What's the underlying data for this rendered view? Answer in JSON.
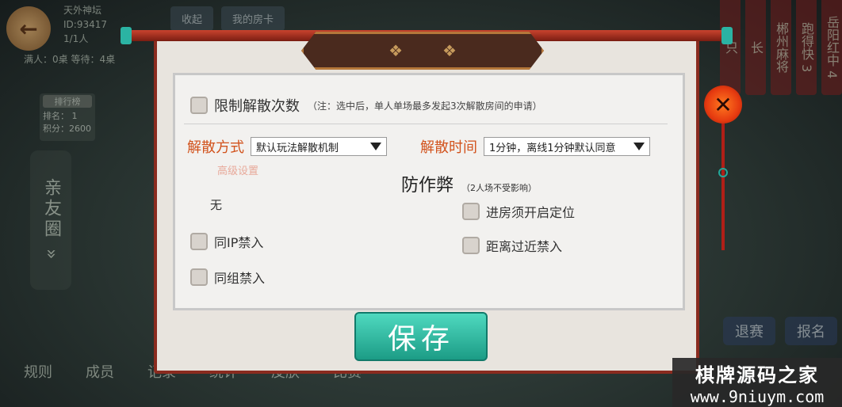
{
  "background": {
    "player_name": "天外神坛",
    "player_id": "ID:93417",
    "player_count": "1/1人",
    "tables_stats": "满人：0桌  等待：4桌",
    "rank_title": "排行榜",
    "rank": "排名：  1",
    "score": "积分：2600",
    "friend_circle": "亲友圈 »",
    "top_tabs": [
      "收起",
      "我的房卡"
    ],
    "right_banners": [
      "只",
      "长",
      "郴州麻将",
      "跑得快 3",
      "岳阳红中 4"
    ],
    "side_buttons": [
      "退赛",
      "报名"
    ],
    "bottom_menu": [
      "规则",
      "成员",
      "记录",
      "统计",
      "皮肤",
      "比赛"
    ]
  },
  "dialog": {
    "header_icons": [
      "ornament-left",
      "ornament-right"
    ],
    "limit_dismiss": {
      "label": "限制解散次数",
      "note": "（注：选中后，单人单场最多发起3次解散房间的申请）",
      "checked": false
    },
    "dismiss_method": {
      "label": "解散方式",
      "selected": "默认玩法解散机制"
    },
    "dismiss_time": {
      "label": "解散时间",
      "selected": "1分钟，离线1分钟默认同意"
    },
    "advanced_settings": "高级设置",
    "none_text": "无",
    "anti_cheat": {
      "title": "防作弊",
      "note": "（2人场不受影响）"
    },
    "options_left": [
      {
        "label": "同IP禁入",
        "checked": false
      },
      {
        "label": "同组禁入",
        "checked": false
      }
    ],
    "options_right": [
      {
        "label": "进房须开启定位",
        "checked": false
      },
      {
        "label": "距离过近禁入",
        "checked": false
      }
    ],
    "save_label": "保存",
    "close_icon": "✕"
  },
  "watermark": {
    "line1": "棋牌源码之家",
    "line2": "www.9niuym.com"
  },
  "colors": {
    "frame": "#8a2b1f",
    "red_label": "#d2531d",
    "save_button": "#2bb69c"
  }
}
